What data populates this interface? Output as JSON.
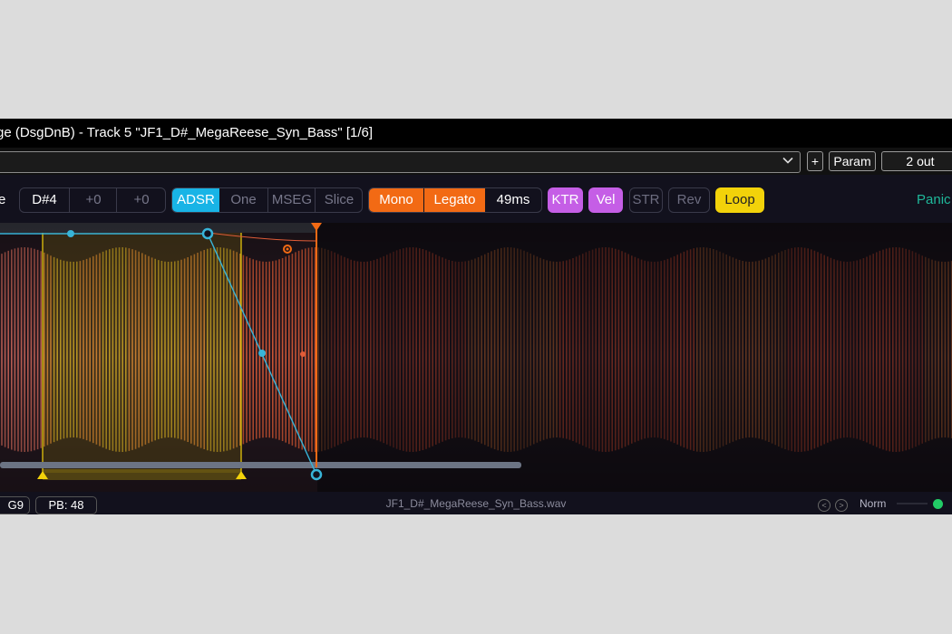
{
  "window": {
    "title": "ge (DsgDnB) - Track 5 \"JF1_D#_MegaReese_Syn_Bass\" [1/6]"
  },
  "host": {
    "plus_label": "+",
    "param_label": "Param",
    "output_label": "2 out"
  },
  "toolbar": {
    "mode_label_partial": "e",
    "root_note": "D#4",
    "transpose_1": "+0",
    "transpose_2": "+0",
    "env_modes": [
      "ADSR",
      "One",
      "MSEG",
      "Slice"
    ],
    "mono_label": "Mono",
    "legato_label": "Legato",
    "glide_time": "49ms",
    "ktr_label": "KTR",
    "vel_label": "Vel",
    "str_label": "STR",
    "rev_label": "Rev",
    "loop_label": "Loop",
    "panic_label": "Panic"
  },
  "status": {
    "left_partial": "G9",
    "pitch_bend": "PB: 48",
    "filename": "JF1_D#_MegaReese_Syn_Bass.wav",
    "prev_label": "<",
    "next_label": ">",
    "norm_label": "Norm"
  },
  "colors": {
    "adsr_active": "#18b4e6",
    "mono": "#f26a14",
    "ktr_vel": "#c55ee6",
    "loop": "#f2d20a",
    "env_line": "#38b4d8",
    "panic": "#1fb89a",
    "led": "#22cc66"
  }
}
